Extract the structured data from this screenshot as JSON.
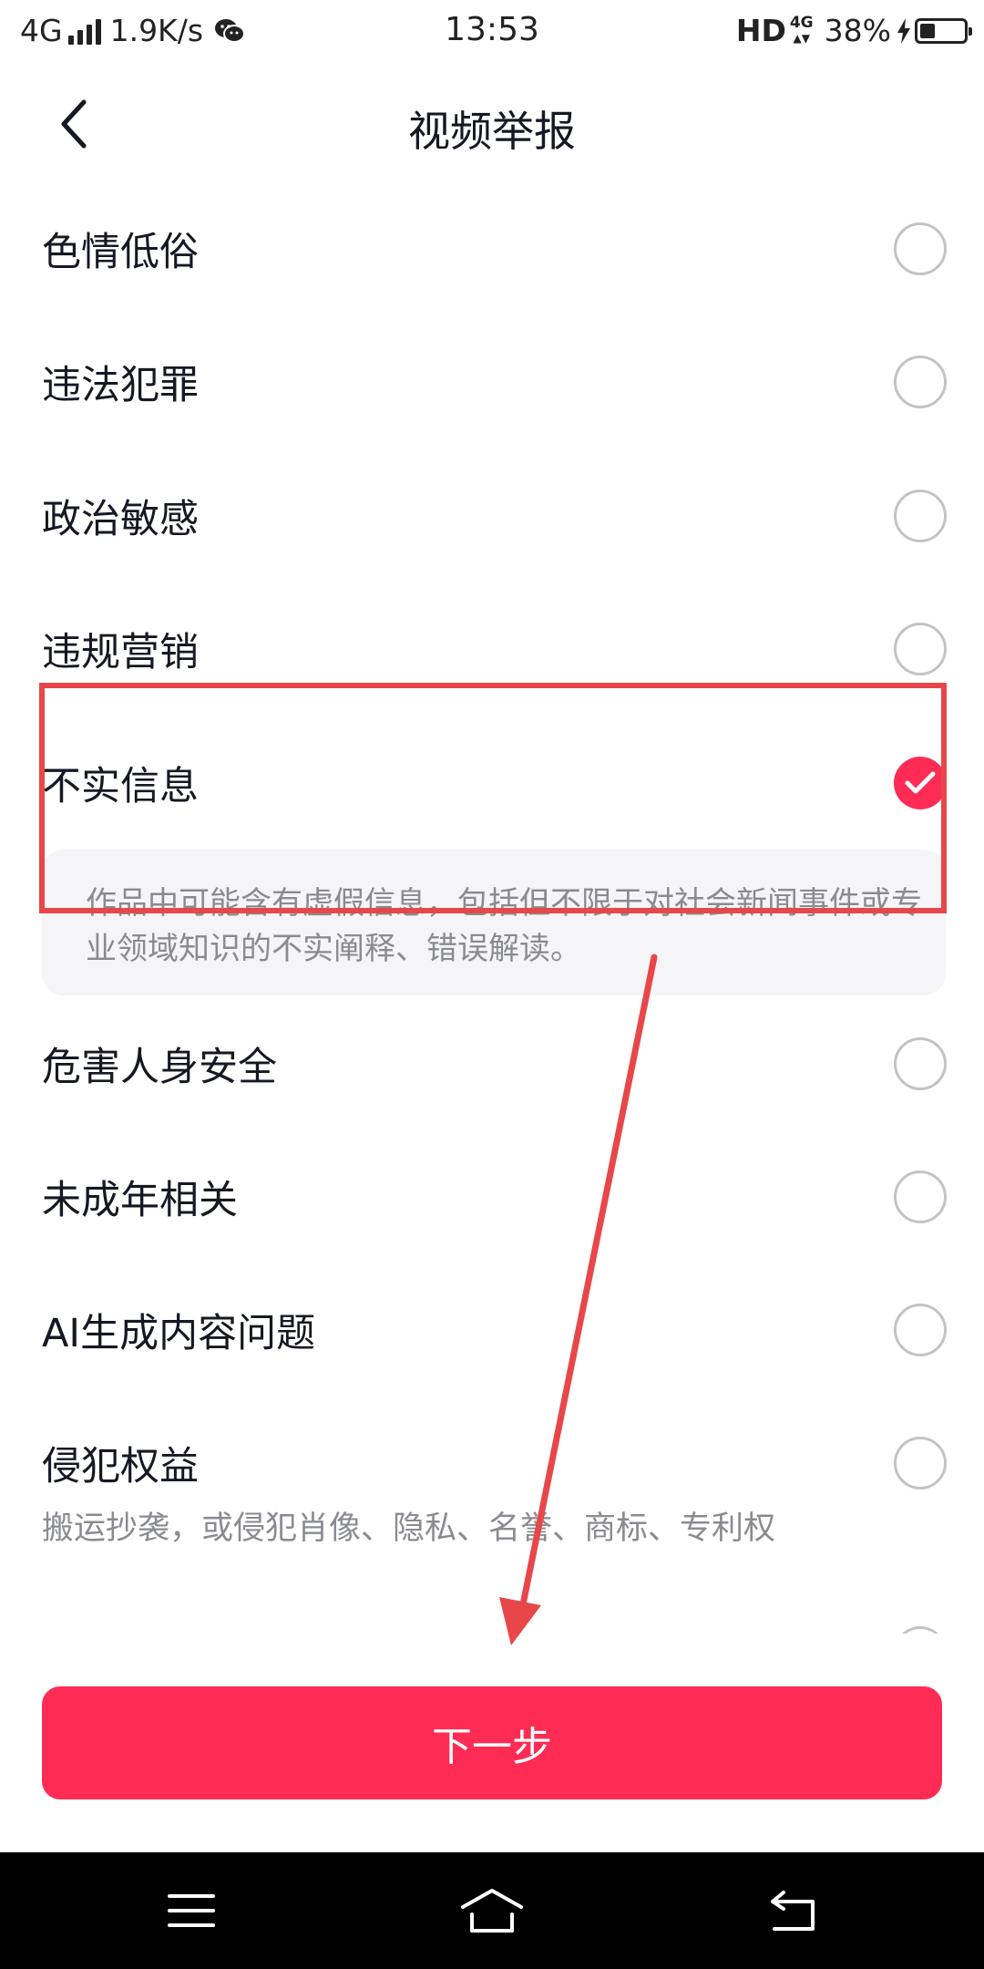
{
  "status_bar": {
    "network": "4G",
    "speed": "1.9K/s",
    "time": "13:53",
    "hd": "HD",
    "network_right": "4G",
    "battery_percent": "38%",
    "battery_level": 0.38,
    "icons": [
      "signal-icon",
      "wechat-icon",
      "charging-icon",
      "battery-icon"
    ]
  },
  "header": {
    "title": "视频举报",
    "back_icon": "chevron-left-icon"
  },
  "reasons": [
    {
      "label": "色情低俗",
      "selected": false
    },
    {
      "label": "违法犯罪",
      "selected": false
    },
    {
      "label": "政治敏感",
      "selected": false
    },
    {
      "label": "违规营销",
      "selected": false
    },
    {
      "label": "不实信息",
      "selected": true,
      "description": "作品中可能含有虚假信息，包括但不限于对社会新闻事件或专业领域知识的不实阐释、错误解读。"
    },
    {
      "label": "危害人身安全",
      "selected": false
    },
    {
      "label": "未成年相关",
      "selected": false
    },
    {
      "label": "AI生成内容问题",
      "selected": false
    },
    {
      "label": "侵犯权益",
      "selected": false,
      "subtitle": "搬运抄袭，或侵犯肖像、隐私、名誉、商标、专利权"
    }
  ],
  "footer": {
    "next_label": "下一步"
  },
  "colors": {
    "accent": "#fe2c55",
    "annotation": "#e8474a"
  },
  "nav_bar": {
    "icons": [
      "menu-icon",
      "home-icon",
      "back-icon"
    ]
  }
}
